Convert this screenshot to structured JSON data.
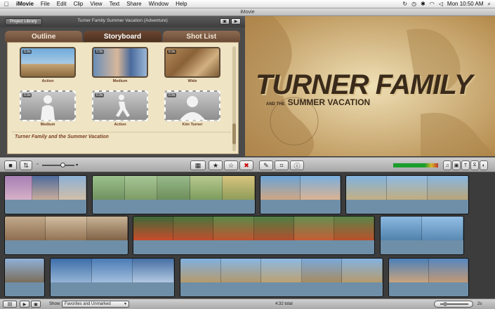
{
  "menubar": {
    "apple": "",
    "items": [
      "iMovie",
      "File",
      "Edit",
      "Clip",
      "View",
      "Text",
      "Share",
      "Window",
      "Help"
    ],
    "clock": "Mon 10:50 AM"
  },
  "window": {
    "title": "iMovie"
  },
  "project": {
    "library_button": "Project Library",
    "title": "Turner Family Summer Vacation (Adventure)"
  },
  "tabs": [
    "Outline",
    "Storyboard",
    "Shot List"
  ],
  "shots": [
    {
      "duration": "0.9s",
      "label": "Action"
    },
    {
      "duration": "0.9s",
      "label": "Medium"
    },
    {
      "duration": "0.9s",
      "label": "Wide"
    },
    {
      "duration": "0.9s",
      "label": "Medium"
    },
    {
      "duration": "0.9s",
      "label": "Action"
    },
    {
      "duration": "0.9s",
      "label": "Kim Turner"
    }
  ],
  "storyboard_caption": "Turner Family and the Summer Vacation",
  "preview": {
    "title_line1": "TURNER FAMILY",
    "title_line2_prefix": "AND THE",
    "title_line2_main": "SUMMER VACATION"
  },
  "status": {
    "show_label": "Show:",
    "filter_value": "Favorites and Unmarked",
    "total": "4:32 total",
    "zoom": "2s"
  }
}
